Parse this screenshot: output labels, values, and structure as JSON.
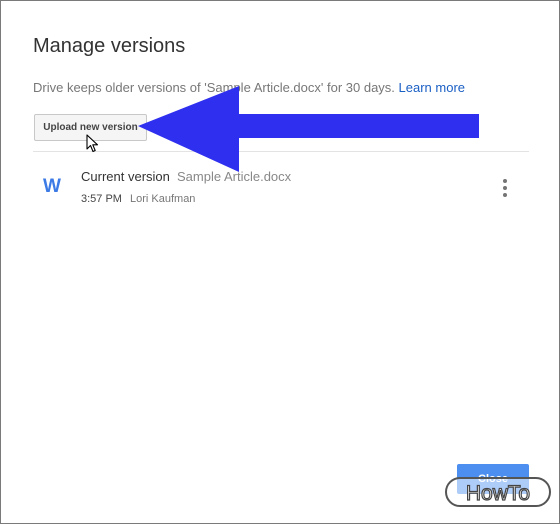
{
  "dialog": {
    "title": "Manage versions",
    "description": "Drive keeps older versions of 'Sample Article.docx' for 30 days.",
    "learn_more": "Learn more",
    "upload_button": "Upload new version",
    "close_button": "Close"
  },
  "versions": [
    {
      "icon": "word-doc-icon",
      "icon_letter": "W",
      "label": "Current version",
      "filename": "Sample Article.docx",
      "time": "3:57 PM",
      "author": "Lori Kaufman"
    }
  ],
  "annotation": {
    "arrow_color": "#2f2ff0",
    "points_to": "upload-new-version-button"
  },
  "watermark": {
    "logo_text": "HowTo"
  },
  "colors": {
    "link": "#1a5fc4",
    "primary_button": "#4d8ff0",
    "word_icon": "#3c7ae6"
  }
}
